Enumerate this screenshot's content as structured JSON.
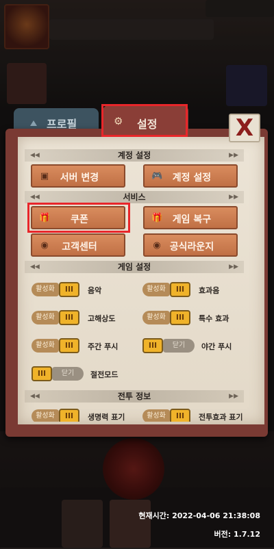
{
  "tabs": {
    "profile": "프로필",
    "settings": "설정"
  },
  "close": "X",
  "sections": {
    "account": "계정 설정",
    "service": "서비스",
    "game": "게임 설정",
    "battle": "전투 정보"
  },
  "account_buttons": {
    "server_change": "서버 변경",
    "account_settings": "계정 설정"
  },
  "service_buttons": {
    "coupon": "쿠폰",
    "game_restore": "게임 복구",
    "customer_center": "고객센터",
    "official_lounge": "공식라운지"
  },
  "toggle_states": {
    "on": "활성화",
    "off": "닫기",
    "knob": "III"
  },
  "toggles": {
    "music": "음악",
    "sfx": "효과음",
    "hires": "고해상도",
    "special_fx": "특수 효과",
    "day_push": "주간 푸시",
    "night_push": "야간 푸시",
    "power_save": "절전모드"
  },
  "battle_toggles": {
    "hp_display": "생명력 표기",
    "battle_fx_display": "전투효과 표기"
  },
  "footer": {
    "time": "현재시간: 2022-04-06 21:38:08",
    "version": "버전: 1.7.12"
  }
}
